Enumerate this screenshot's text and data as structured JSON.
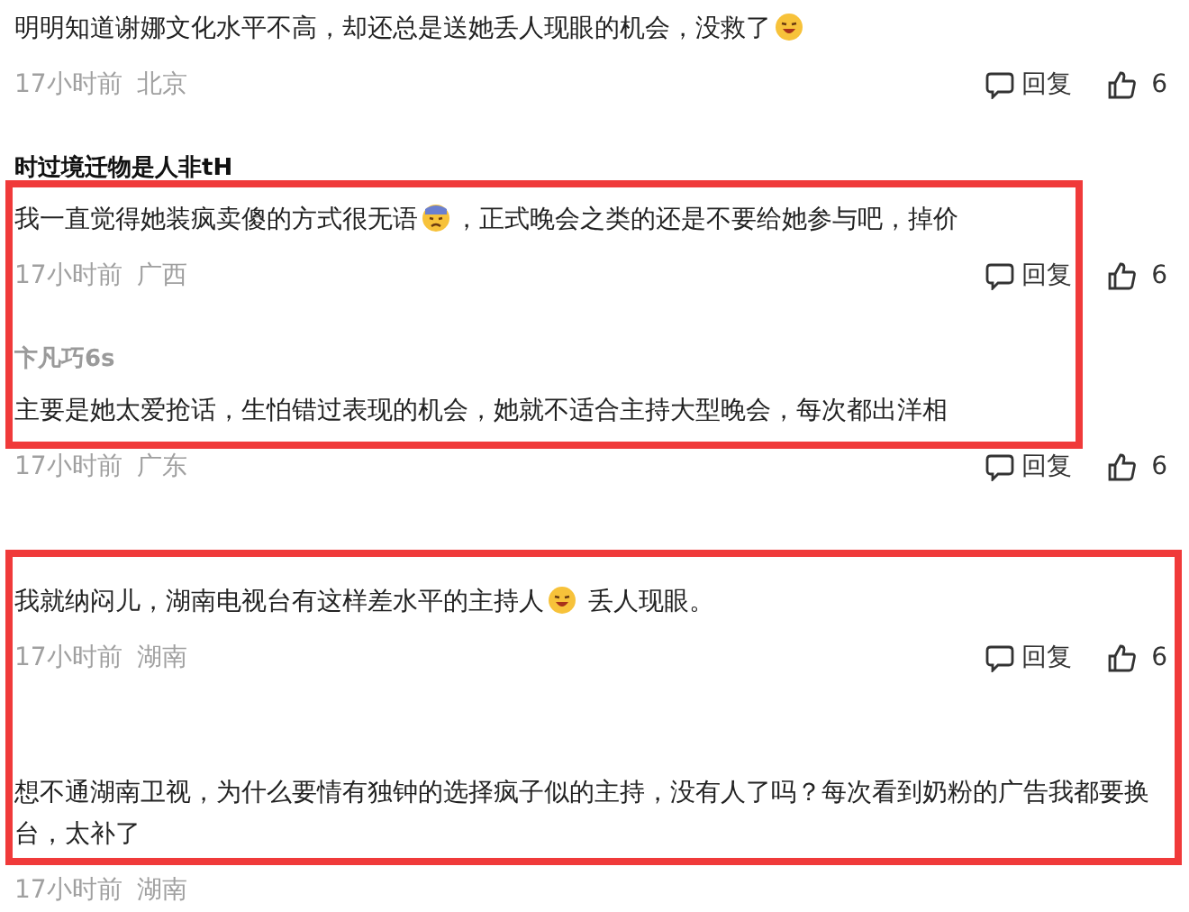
{
  "comments": [
    {
      "body": [
        {
          "kind": "text",
          "text": "明明知道谢娜文化水平不高，却还总是送她丢人现眼的机会，没救了"
        },
        {
          "kind": "laugh-emoji"
        }
      ],
      "time": "17小时前",
      "location": "北京",
      "reply": "回复",
      "likes": "6"
    },
    {
      "user": {
        "name": "时过境迁物是人非tH",
        "faded": false
      },
      "body": [
        {
          "kind": "text",
          "text": "我一直觉得她装疯卖傻的方式很无语"
        },
        {
          "kind": "sad-emoji"
        },
        {
          "kind": "text",
          "text": "，正式晚会之类的还是不要给她参与吧，掉价"
        }
      ],
      "time": "17小时前",
      "location": "广西",
      "reply": "回复",
      "likes": "6"
    },
    {
      "user": {
        "name": "卞凡巧6s",
        "faded": true
      },
      "body": [
        {
          "kind": "text",
          "text": "主要是她太爱抢话，生怕错过表现的机会，她就不适合主持大型晚会，每次都出洋相"
        }
      ],
      "time": "17小时前",
      "location": "广东",
      "reply": "回复",
      "likes": "6"
    },
    {
      "body": [
        {
          "kind": "text",
          "text": "我就纳闷儿，湖南电视台有这样差水平的主持人"
        },
        {
          "kind": "laugh-emoji"
        },
        {
          "kind": "text",
          "text": " 丢人现眼。"
        }
      ],
      "time": "17小时前",
      "location": "湖南",
      "reply": "回复",
      "likes": "6"
    },
    {
      "body": [
        {
          "kind": "text",
          "text": "想不通湖南卫视，为什么要情有独钟的选择疯子似的主持，没有人了吗？每次看到奶粉的广告我都要换台，太补了"
        }
      ],
      "time": "17小时前",
      "location": "湖南"
    }
  ],
  "highlight_boxes": [
    {
      "color": "#f03a3a"
    },
    {
      "color": "#f03a3a"
    }
  ]
}
